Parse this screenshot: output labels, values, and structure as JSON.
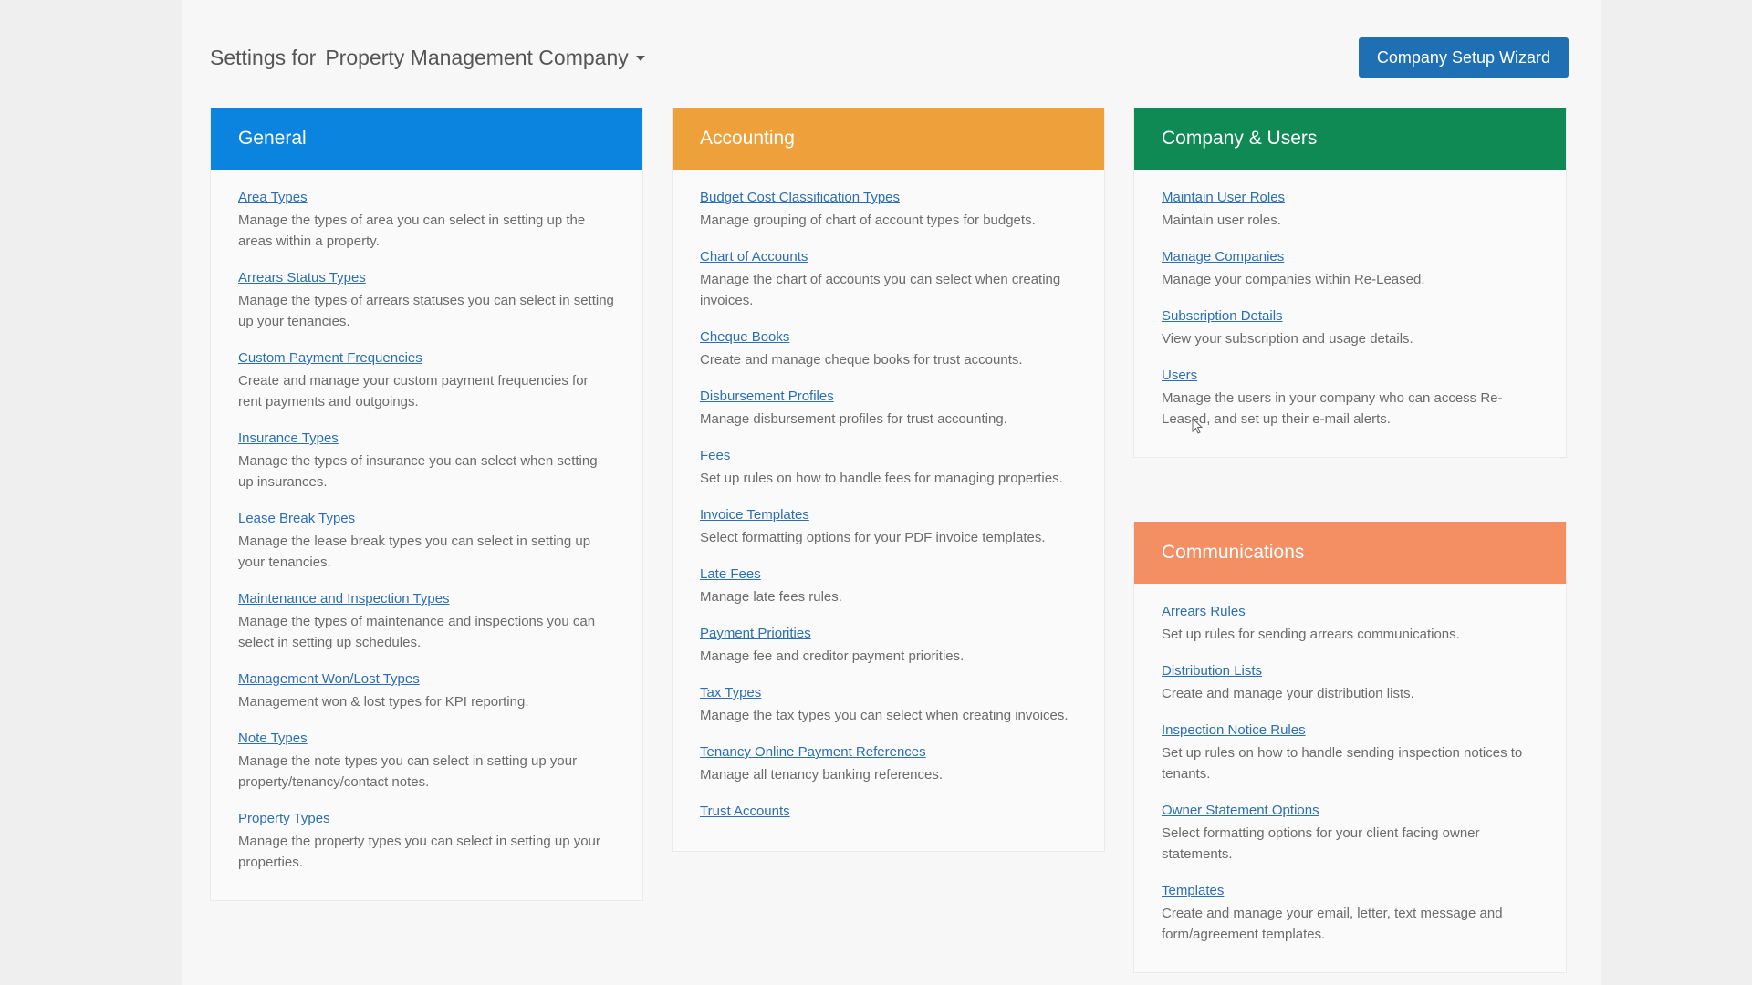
{
  "header": {
    "settings_for": "Settings for",
    "company_name": "Property Management Company",
    "wizard_button": "Company Setup Wizard"
  },
  "colors": {
    "general": "#0b84e0",
    "accounting": "#eea13b",
    "company_users": "#0f8a55",
    "communications": "#f48f63",
    "link": "#2a6fb4"
  },
  "panels": {
    "general": {
      "title": "General",
      "items": [
        {
          "link": "Area Types",
          "desc": "Manage the types of area you can select in setting up the areas within a property."
        },
        {
          "link": "Arrears Status Types",
          "desc": "Manage the types of arrears statuses you can select in setting up your tenancies."
        },
        {
          "link": "Custom Payment Frequencies",
          "desc": "Create and manage your custom payment frequencies for rent payments and outgoings."
        },
        {
          "link": "Insurance Types",
          "desc": "Manage the types of insurance you can select when setting up insurances."
        },
        {
          "link": "Lease Break Types",
          "desc": "Manage the lease break types you can select in setting up your tenancies."
        },
        {
          "link": "Maintenance and Inspection Types",
          "desc": "Manage the types of maintenance and inspections you can select in setting up schedules."
        },
        {
          "link": "Management Won/Lost Types",
          "desc": "Management won & lost types for KPI reporting."
        },
        {
          "link": "Note Types",
          "desc": "Manage the note types you can select in setting up your property/tenancy/contact notes."
        },
        {
          "link": "Property Types",
          "desc": "Manage the property types you can select in setting up your properties."
        }
      ]
    },
    "accounting": {
      "title": "Accounting",
      "items": [
        {
          "link": "Budget Cost Classification Types",
          "desc": "Manage grouping of chart of account types for budgets."
        },
        {
          "link": "Chart of Accounts",
          "desc": "Manage the chart of accounts you can select when creating invoices."
        },
        {
          "link": "Cheque Books",
          "desc": "Create and manage cheque books for trust accounts."
        },
        {
          "link": "Disbursement Profiles",
          "desc": "Manage disbursement profiles for trust accounting."
        },
        {
          "link": "Fees",
          "desc": "Set up rules on how to handle fees for managing properties."
        },
        {
          "link": "Invoice Templates",
          "desc": "Select formatting options for your PDF invoice templates."
        },
        {
          "link": "Late Fees",
          "desc": "Manage late fees rules."
        },
        {
          "link": "Payment Priorities",
          "desc": "Manage fee and creditor payment priorities."
        },
        {
          "link": "Tax Types",
          "desc": "Manage the tax types you can select when creating invoices."
        },
        {
          "link": "Tenancy Online Payment References",
          "desc": "Manage all tenancy banking references."
        },
        {
          "link": "Trust Accounts",
          "desc": ""
        }
      ]
    },
    "company_users": {
      "title": "Company & Users",
      "items": [
        {
          "link": "Maintain User Roles",
          "desc": "Maintain user roles."
        },
        {
          "link": "Manage Companies",
          "desc": "Manage your companies within Re-Leased."
        },
        {
          "link": "Subscription Details",
          "desc": "View your subscription and usage details."
        },
        {
          "link": "Users",
          "desc": "Manage the users in your company who can access Re-Leased, and set up their e-mail alerts."
        }
      ]
    },
    "communications": {
      "title": "Communications",
      "items": [
        {
          "link": "Arrears Rules",
          "desc": "Set up rules for sending arrears communications."
        },
        {
          "link": "Distribution Lists",
          "desc": "Create and manage your distribution lists."
        },
        {
          "link": "Inspection Notice Rules",
          "desc": "Set up rules on how to handle sending inspection notices to tenants."
        },
        {
          "link": "Owner Statement Options",
          "desc": "Select formatting options for your client facing owner statements."
        },
        {
          "link": "Templates",
          "desc": "Create and manage your email, letter, text message and form/agreement templates."
        }
      ]
    }
  }
}
